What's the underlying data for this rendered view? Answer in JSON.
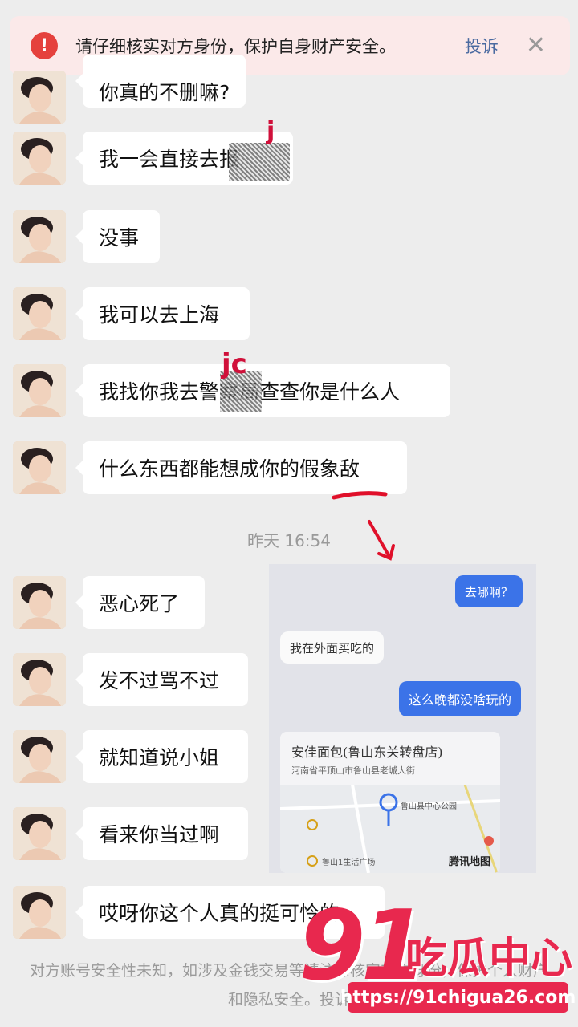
{
  "warning": {
    "text": "请仔细核实对方身份，保护自身财产安全。",
    "complain_label": "投诉",
    "close_glyph": "✕"
  },
  "messages": [
    {
      "text": "你真的不删嘛?"
    },
    {
      "text": "我一会直接去报"
    },
    {
      "text": "没事"
    },
    {
      "text": "我可以去上海"
    },
    {
      "text": "我找你我去警察局查查你是什么人"
    },
    {
      "text": "什么东西都能想成你的假象敌"
    },
    {
      "text": "恶心死了"
    },
    {
      "text": "发不过骂不过"
    },
    {
      "text": "就知道说小姐"
    },
    {
      "text": "看来你当过啊"
    },
    {
      "text": "哎呀你这个人真的挺可怜的"
    }
  ],
  "timestamp": "昨天 16:54",
  "annotations": {
    "mark_1": "j",
    "mark_2": "jc"
  },
  "inset": {
    "msg1": "去哪啊？",
    "msg2": "我在外面买吃的",
    "msg3": "这么晚都没啥玩的",
    "map_title": "安佳面包(鲁山东关转盘店)",
    "map_address": "河南省平顶山市鲁山县老城大街",
    "map_poi": "鲁山县中心公园",
    "map_poi2": "鲁山1生活广场",
    "map_brand": "腾讯地图"
  },
  "footer": {
    "notice": "对方账号安全性未知，如涉及金钱交易等请注意核实对方身份，保护个人财产和隐私安全。投诉"
  },
  "watermark": {
    "number": "91",
    "text": "吃瓜中心",
    "url": "https://91chigua26.com"
  },
  "colors": {
    "accent": "#e8284e",
    "alert": "#e5413d",
    "link": "#4a6aa0",
    "bubble_blue": "#3b73e8"
  }
}
